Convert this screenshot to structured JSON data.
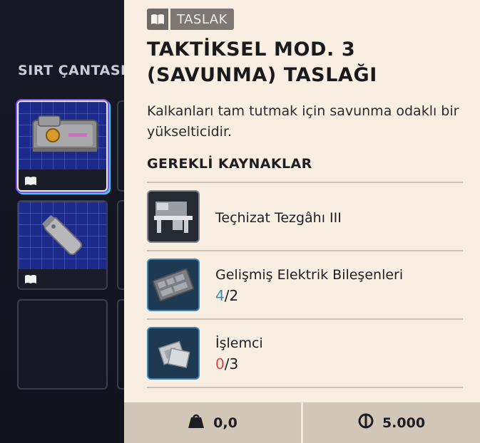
{
  "backpack": {
    "title": "SIRT ÇANTASI"
  },
  "detail": {
    "tag_label": "TASLAK",
    "tag_icon": "open-book-icon",
    "title": "TAKTİKSEL MOD. 3 (SAVUNMA) TASLAĞI",
    "description": "Kalkanları tam tutmak için savunma odaklı bir yükselticidir.",
    "requirements_header": "GEREKLİ KAYNAKLAR",
    "resources": [
      {
        "name": "Teçhizat Tezgâhı III",
        "icon": "workbench-icon"
      },
      {
        "name": "Gelişmiş Elektrik Bileşenleri",
        "have": "4",
        "need": "/2",
        "icon": "circuit-board-icon"
      },
      {
        "name": "İşlemci",
        "have": "0",
        "need": "/3",
        "icon": "processor-icon"
      }
    ]
  },
  "footer": {
    "weight": "0,0",
    "weight_icon": "weight-bag-icon",
    "price": "5.000",
    "price_icon": "coin-icon"
  },
  "colors": {
    "panel_bg": "#f8eee2",
    "footer_bg": "#d2c6b8",
    "have_ok": "#3a8fb5",
    "have_bad": "#e0473c",
    "slot_selected_glow": "#7a4dff"
  }
}
